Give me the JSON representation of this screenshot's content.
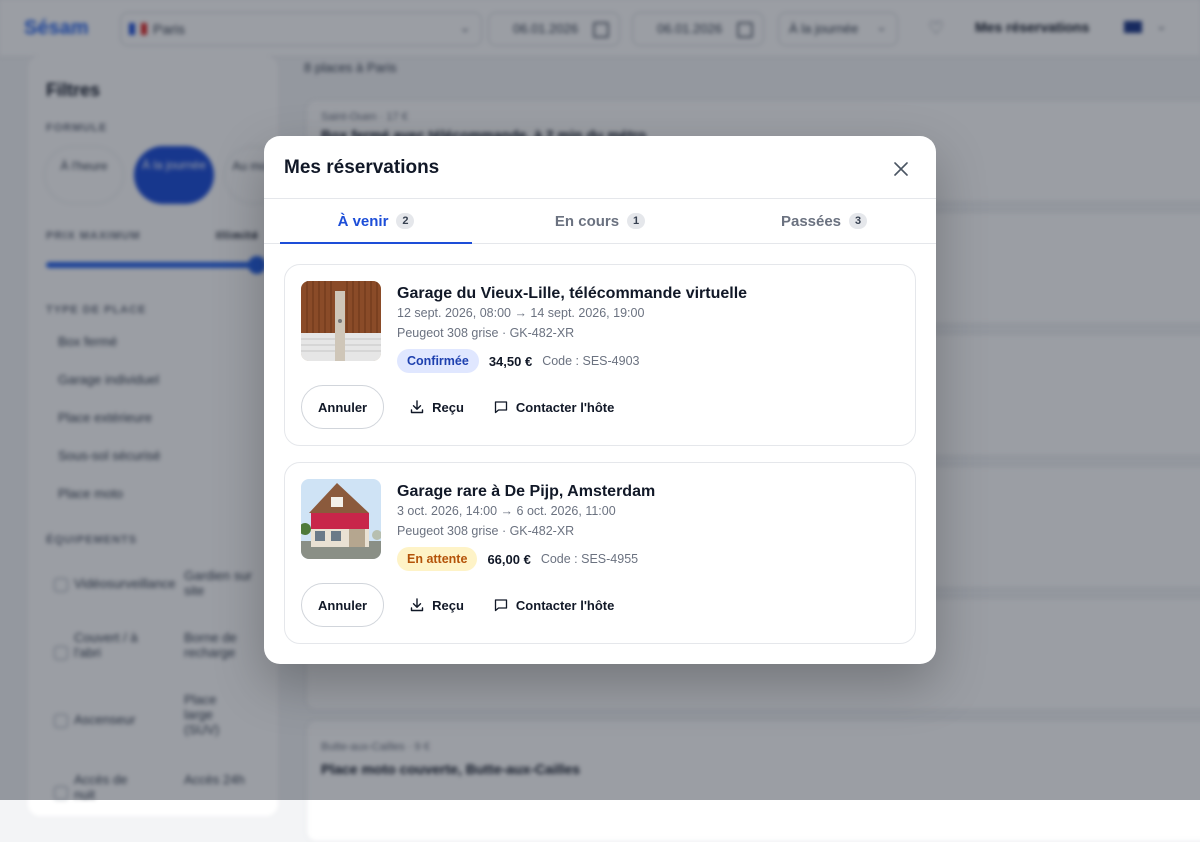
{
  "topbar": {
    "brand": "Sésam",
    "city": "Paris",
    "date_start": "06.01.2026",
    "date_end": "06.01.2026",
    "duration": "À la journée",
    "my_bookings_link": "Mes réservations"
  },
  "sidebar": {
    "title": "Filtres",
    "formula_label": "FORMULE",
    "formula_options": [
      "À l'heure",
      "À la journée",
      "Au mois"
    ],
    "price_label": "PRIX MAXIMUM",
    "price_value": "Illimité",
    "type_label": "TYPE DE PLACE",
    "types": [
      "Box fermé",
      "Garage individuel",
      "Place extérieure",
      "Sous-sol sécurisé",
      "Place moto"
    ],
    "equip_label": "ÉQUIPEMENTS",
    "equipments": [
      [
        "Vidéosurveillance",
        "Gardien sur site"
      ],
      [
        "Couvert / à l'abri",
        "Borne de recharge"
      ],
      [
        "Ascenseur",
        "Place large (SUV)"
      ],
      [
        "Accès de nuit",
        "Accès 24h"
      ]
    ]
  },
  "results": {
    "count": "8 places à Paris",
    "cards": [
      {
        "sub": "Saint-Ouen · 17 €",
        "title": "Box fermé avec télécommande, à 2 min du métro"
      },
      {
        "sub": "",
        "title": ""
      },
      {
        "sub": "",
        "title": ""
      },
      {
        "sub": "",
        "title": ""
      },
      {
        "sub": "",
        "title": ""
      },
      {
        "sub": "Butte-aux-Cailles · 9 €",
        "title": "Place moto couverte, Butte-aux-Cailles"
      }
    ]
  },
  "modal": {
    "title": "Mes réservations",
    "tabs": [
      {
        "label": "À venir",
        "count": "2"
      },
      {
        "label": "En cours",
        "count": "1"
      },
      {
        "label": "Passées",
        "count": "3"
      }
    ],
    "bookings": [
      {
        "title": "Garage du Vieux-Lille, télécommande virtuelle",
        "dates": "12 sept. 2026, 08:00 → 14 sept. 2026, 19:00",
        "car": "Peugeot 308 grise · GK-482-XR",
        "status": "Confirmée",
        "price": "34,50 €",
        "code": "Code : SES-4903",
        "cancel_label": "Annuler",
        "receipt_label": "Reçu",
        "contact_label": "Contacter l'hôte"
      },
      {
        "title": "Garage rare à De Pijp, Amsterdam",
        "dates": "3 oct. 2026, 14:00 → 6 oct. 2026, 11:00",
        "car": "Peugeot 308 grise · GK-482-XR",
        "status": "En attente",
        "price": "66,00 €",
        "code": "Code : SES-4955",
        "cancel_label": "Annuler",
        "receipt_label": "Reçu",
        "contact_label": "Contacter l'hôte"
      }
    ]
  },
  "colors": {
    "accent": "#1d4ed8",
    "confirmed_bg": "#e0e7ff",
    "pending_bg": "#fef3c7",
    "pending_text": "#b45309"
  }
}
